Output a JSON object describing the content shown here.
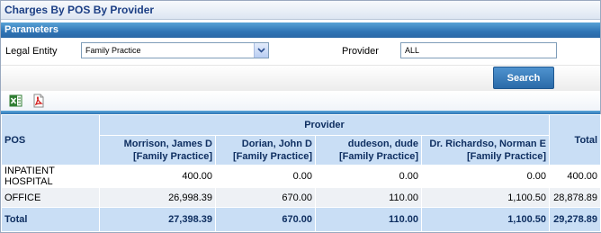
{
  "page": {
    "title": "Charges By POS By Provider"
  },
  "parameters": {
    "section_title": "Parameters",
    "legal_entity_label": "Legal Entity",
    "legal_entity_value": "Family Practice",
    "provider_label": "Provider",
    "provider_value": "ALL",
    "search_label": "Search"
  },
  "export": {
    "excel_icon": "excel-icon",
    "pdf_icon": "pdf-icon"
  },
  "report": {
    "pos_header": "POS",
    "provider_group_header": "Provider",
    "total_header": "Total",
    "providers": [
      {
        "name": "Morrison, James D",
        "entity": "[Family Practice]"
      },
      {
        "name": "Dorian, John D",
        "entity": "[Family Practice]"
      },
      {
        "name": "dudeson, dude",
        "entity": "[Family Practice]"
      },
      {
        "name": "Dr. Richardso, Norman E",
        "entity": "[Family Practice]"
      }
    ],
    "rows": [
      {
        "pos": "INPATIENT HOSPITAL",
        "values": [
          "400.00",
          "0.00",
          "0.00",
          "0.00"
        ],
        "total": "400.00"
      },
      {
        "pos": "OFFICE",
        "values": [
          "26,998.39",
          "670.00",
          "110.00",
          "1,100.50"
        ],
        "total": "28,878.89"
      }
    ],
    "totals": {
      "label": "Total",
      "values": [
        "27,398.39",
        "670.00",
        "110.00",
        "1,100.50"
      ],
      "grand_total": "29,278.89"
    }
  }
}
